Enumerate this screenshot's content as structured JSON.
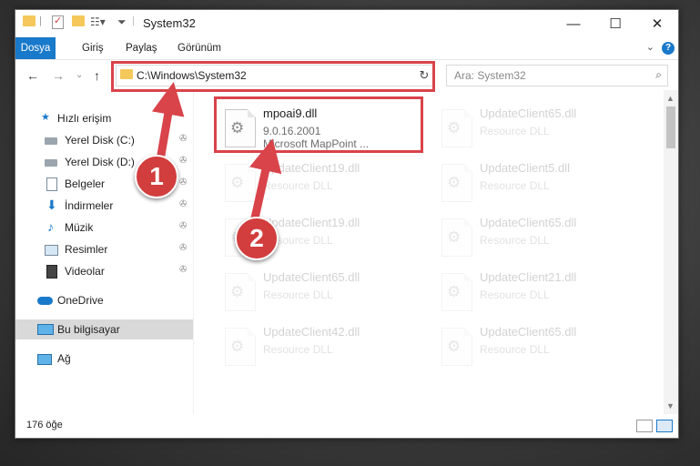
{
  "window": {
    "title": "System32",
    "controls": {
      "minimize": "—",
      "maximize": "☐",
      "close": "✕"
    }
  },
  "ribbon": {
    "tabs": [
      "Dosya",
      "Giriş",
      "Paylaş",
      "Görünüm"
    ],
    "active_tab": "Dosya",
    "expand": "⌄",
    "help": "?"
  },
  "navbar": {
    "back": "←",
    "forward": "→",
    "recent": "⌄",
    "up": "↑",
    "address": "C:\\Windows\\System32",
    "refresh": "↻",
    "search_placeholder": "Ara: System32"
  },
  "nav_pane": {
    "items": [
      {
        "label": "Hızlı erişim",
        "icon": "star-icon",
        "pinned": false
      },
      {
        "label": "Yerel Disk (C:)",
        "icon": "drive-icon",
        "pinned": true
      },
      {
        "label": "Yerel Disk (D:)",
        "icon": "drive-icon",
        "pinned": true
      },
      {
        "label": "Belgeler",
        "icon": "documents-icon",
        "pinned": true
      },
      {
        "label": "İndirmeler",
        "icon": "download-icon",
        "pinned": true
      },
      {
        "label": "Müzik",
        "icon": "music-icon",
        "pinned": true
      },
      {
        "label": "Resimler",
        "icon": "pictures-icon",
        "pinned": true
      },
      {
        "label": "Videolar",
        "icon": "videos-icon",
        "pinned": true
      },
      {
        "label": "OneDrive",
        "icon": "cloud-icon",
        "pinned": false
      },
      {
        "label": "Bu bilgisayar",
        "icon": "computer-icon",
        "pinned": false
      },
      {
        "label": "Ağ",
        "icon": "network-icon",
        "pinned": false
      }
    ],
    "selected": "Bu bilgisayar",
    "pin_glyph": "📌"
  },
  "files": [
    {
      "name": "mpoai9.dll",
      "line1": "9.0.16.2001",
      "line2": "Microsoft MapPoint ...",
      "highlighted": true
    },
    {
      "name": "UpdateClient65.dll",
      "line1": "Resource DLL",
      "highlighted": false
    },
    {
      "name": "UpdateClient19.dll",
      "line1": "Resource DLL",
      "highlighted": false
    },
    {
      "name": "UpdateClient5.dll",
      "line1": "Resource DLL",
      "highlighted": false
    },
    {
      "name": "UpdateClient19.dll",
      "line1": "Resource DLL",
      "highlighted": false
    },
    {
      "name": "UpdateClient65.dll",
      "line1": "Resource DLL",
      "highlighted": false
    },
    {
      "name": "UpdateClient65.dll",
      "line1": "Resource DLL",
      "highlighted": false
    },
    {
      "name": "UpdateClient21.dll",
      "line1": "Resource DLL",
      "highlighted": false
    },
    {
      "name": "UpdateClient42.dll",
      "line1": "Resource DLL",
      "highlighted": false
    },
    {
      "name": "UpdateClient65.dll",
      "line1": "Resource DLL",
      "highlighted": false
    }
  ],
  "status": {
    "count": "176 öğe"
  },
  "annotations": {
    "step1": "1",
    "step2": "2",
    "color": "#d9434a"
  }
}
